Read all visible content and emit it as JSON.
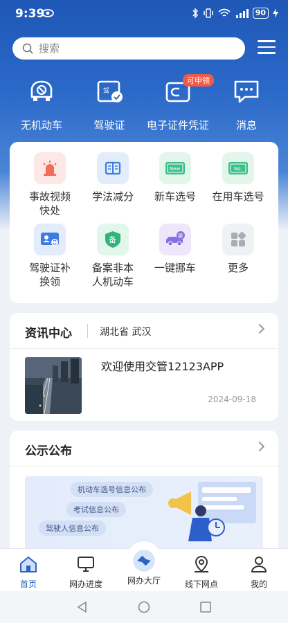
{
  "status": {
    "time": "9:39",
    "battery": "90"
  },
  "search": {
    "placeholder": "搜索"
  },
  "quick_actions": [
    {
      "label": "无机动车",
      "icon": "car-icon"
    },
    {
      "label": "驾驶证",
      "icon": "license-icon"
    },
    {
      "label": "电子证件凭证",
      "icon": "wallet-icon",
      "badge": "可申领"
    },
    {
      "label": "消息",
      "icon": "message-icon"
    }
  ],
  "services": [
    {
      "label_1": "事故视频",
      "label_2": "快处",
      "icon": "alarm-icon",
      "color": "#f36b5a"
    },
    {
      "label_1": "学法减分",
      "label_2": "",
      "icon": "book-icon",
      "color": "#3c7be0"
    },
    {
      "label_1": "新车选号",
      "label_2": "",
      "icon": "new-plate-icon",
      "color": "#3cc08a"
    },
    {
      "label_1": "在用车选号",
      "label_2": "",
      "icon": "plate-no-icon",
      "color": "#3cc08a"
    },
    {
      "label_1": "驾驶证补",
      "label_2": "换领",
      "icon": "id-card-icon",
      "color": "#3c7be0"
    },
    {
      "label_1": "备案非本",
      "label_2": "人机动车",
      "icon": "shield-icon",
      "color": "#2fb57a"
    },
    {
      "label_1": "一键挪车",
      "label_2": "",
      "icon": "move-car-icon",
      "color": "#8a6fe0"
    },
    {
      "label_1": "更多",
      "label_2": "",
      "icon": "more-grid-icon",
      "color": "#b9bdc5"
    }
  ],
  "news": {
    "title": "资讯中心",
    "location": "湖北省 武汉",
    "headline": "欢迎使用交管12123APP",
    "date": "2024-09-18"
  },
  "notice": {
    "title": "公示公布",
    "pills": [
      "机动车选号信息公布",
      "考试信息公布",
      "驾驶人信息公布"
    ]
  },
  "bottom_nav": [
    {
      "label": "首页",
      "icon": "home-icon",
      "active": true
    },
    {
      "label": "网办进度",
      "icon": "monitor-icon",
      "active": false
    },
    {
      "label": "网办大厅",
      "icon": "handshake-icon",
      "active": false
    },
    {
      "label": "线下网点",
      "icon": "location-icon",
      "active": false
    },
    {
      "label": "我的",
      "icon": "user-icon",
      "active": false
    }
  ],
  "colors": {
    "brand": "#2a63c0",
    "badge": "#f05a46"
  }
}
